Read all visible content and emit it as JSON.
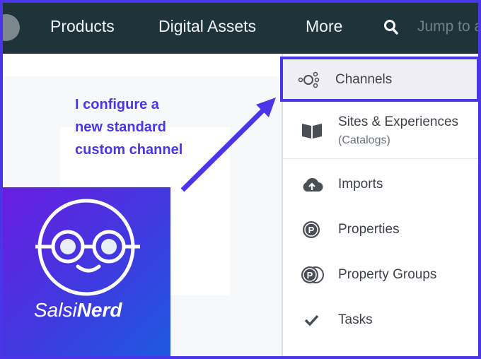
{
  "header": {
    "nav": [
      "Products",
      "Digital Assets",
      "More"
    ],
    "search_placeholder": "Jump to a"
  },
  "annotation": {
    "lines": [
      "I configure a",
      "new standard",
      "custom channel"
    ]
  },
  "logo": {
    "text_light": "Salsi",
    "text_bold": "Nerd"
  },
  "menu": {
    "items": [
      {
        "label": "Channels",
        "icon": "channels-icon"
      },
      {
        "label": "Sites & Experiences",
        "sub": "(Catalogs)",
        "icon": "book-icon"
      },
      {
        "label": "Imports",
        "icon": "cloud-upload-icon"
      },
      {
        "label": "Properties",
        "icon": "property-icon"
      },
      {
        "label": "Property Groups",
        "icon": "property-group-icon"
      },
      {
        "label": "Tasks",
        "icon": "check-icon"
      }
    ]
  },
  "colors": {
    "accent": "#4a35e8",
    "header": "#1f333b"
  }
}
